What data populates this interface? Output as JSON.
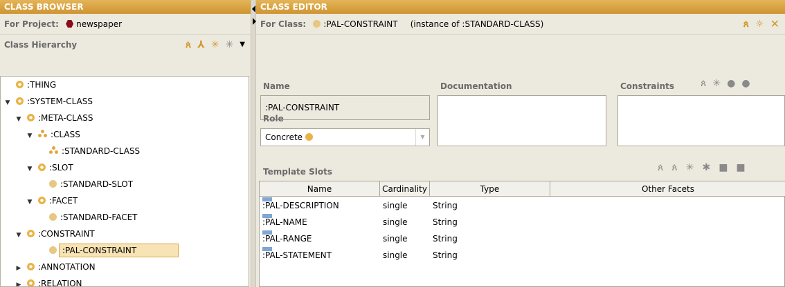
{
  "browser": {
    "title": "CLASS BROWSER",
    "for_label": "For Project:",
    "project_name": "newspaper",
    "hierarchy_label": "Class Hierarchy",
    "tree": [
      {
        "label": ":THING",
        "toggle": "",
        "icon": "ring"
      },
      {
        "label": ":SYSTEM-CLASS",
        "toggle": "▼",
        "icon": "ring"
      },
      {
        "label": ":META-CLASS",
        "toggle": "▼",
        "icon": "ring"
      },
      {
        "label": ":CLASS",
        "toggle": "▼",
        "icon": "tri"
      },
      {
        "label": ":STANDARD-CLASS",
        "toggle": "",
        "icon": "tri"
      },
      {
        "label": ":SLOT",
        "toggle": "▼",
        "icon": "ring"
      },
      {
        "label": ":STANDARD-SLOT",
        "toggle": "",
        "icon": "pale"
      },
      {
        "label": ":FACET",
        "toggle": "▼",
        "icon": "ring"
      },
      {
        "label": ":STANDARD-FACET",
        "toggle": "",
        "icon": "pale"
      },
      {
        "label": ":CONSTRAINT",
        "toggle": "▼",
        "icon": "ring"
      },
      {
        "label": ":PAL-CONSTRAINT",
        "toggle": "",
        "icon": "pale",
        "selected": true
      },
      {
        "label": ":ANNOTATION",
        "toggle": "▶",
        "icon": "ring"
      },
      {
        "label": ":RELATION",
        "toggle": "▶",
        "icon": "ring"
      }
    ]
  },
  "editor": {
    "title": "CLASS EDITOR",
    "for_label": "For Class:",
    "class_name": ":PAL-CONSTRAINT",
    "instance_of": "(instance of :STANDARD-CLASS)",
    "name_label": "Name",
    "name_value": ":PAL-CONSTRAINT",
    "documentation_label": "Documentation",
    "constraints_label": "Constraints",
    "role_label": "Role",
    "role_value": "Concrete",
    "template_slots_label": "Template Slots",
    "columns": [
      "Name",
      "Cardinality",
      "Type",
      "Other Facets"
    ],
    "slots": [
      {
        "name": ":PAL-DESCRIPTION",
        "cardinality": "single",
        "type": "String",
        "facets": ""
      },
      {
        "name": ":PAL-NAME",
        "cardinality": "single",
        "type": "String",
        "facets": ""
      },
      {
        "name": ":PAL-RANGE",
        "cardinality": "single",
        "type": "String",
        "facets": ""
      },
      {
        "name": ":PAL-STATEMENT",
        "cardinality": "single",
        "type": "String",
        "facets": ""
      }
    ]
  },
  "colors": {
    "titlebar": "#d9a441",
    "class_icon": "#e9b345",
    "project_icon": "#8b0b1a",
    "slot_icon": "#7fa7d1",
    "selection": "#f7e3b3"
  }
}
